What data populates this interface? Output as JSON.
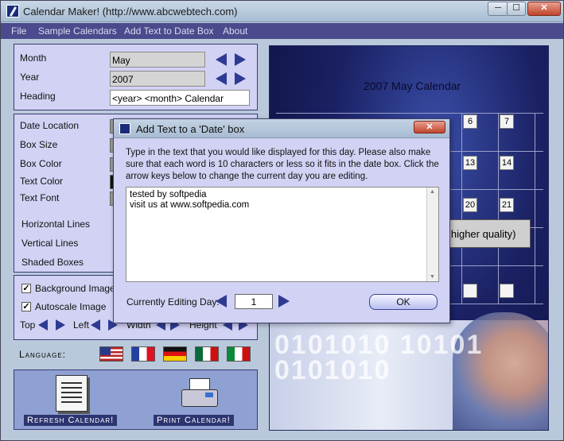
{
  "window": {
    "title": "Calendar Maker! (http://www.abcwebtech.com)",
    "minimize_label": "─",
    "maximize_label": "☐",
    "close_label": "✕"
  },
  "menu": {
    "file": "File",
    "sample_calendars": "Sample Calendars",
    "add_text": "Add Text to Date Box",
    "about": "About"
  },
  "settings": {
    "month_label": "Month",
    "month_value": "May",
    "year_label": "Year",
    "year_value": "2007",
    "heading_label": "Heading",
    "heading_value": "<year> <month> Calendar"
  },
  "style": {
    "date_location": "Date Location",
    "box_size": "Box Size",
    "box_color": "Box Color",
    "text_color": "Text Color",
    "text_font": "Text Font",
    "horizontal_lines": "Horizontal Lines",
    "vertical_lines": "Vertical Lines",
    "shaded_boxes": "Shaded Boxes"
  },
  "options": {
    "background_image": "Background Image",
    "background_image_checked": true,
    "autoscale_image": "Autoscale Image",
    "autoscale_image_checked": true,
    "top": "Top",
    "left": "Left",
    "width": "Width",
    "height": "Height",
    "check_mark": "✓"
  },
  "language": {
    "label": "Language:",
    "flags": [
      "us-flag",
      "france-flag",
      "germany-flag",
      "mexico-flag",
      "italy-flag"
    ]
  },
  "actions": {
    "refresh": "Refresh Calendar!",
    "print": "Print Calendar!"
  },
  "preview": {
    "title": "2007 May Calendar",
    "visible_days": [
      "6",
      "7",
      "13",
      "14",
      "20",
      "21"
    ],
    "quality_note": "h higher quality)",
    "binary_art": "0101010 10101 0101010"
  },
  "dialog": {
    "title": "Add Text to a 'Date' box",
    "close_label": "✕",
    "instructions": "Type in the text that you would like displayed for this day. Please also make sure that each word is 10 characters or less so it fits in the date box. Click the arrow keys below to change the current day you are editing.",
    "text_lines": [
      "tested by softpedia",
      "visit us at www.softpedia.com"
    ],
    "editing_label": "Currently Editing Day:",
    "editing_day": "1",
    "ok_label": "OK"
  },
  "colors": {
    "panel": "#d2d2f4",
    "menubar": "#4a4a8c",
    "arrow": "#2f3b92",
    "preview_bg": "#1a2062"
  }
}
